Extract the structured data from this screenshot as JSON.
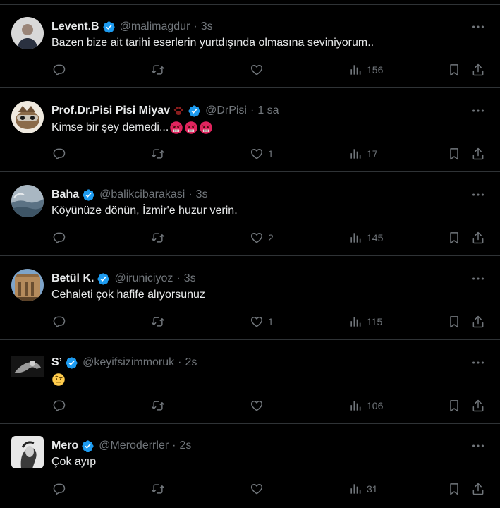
{
  "theme": {
    "background": "#000000",
    "text": "#e7e9ea",
    "muted": "#71767b",
    "divider": "#2f3336",
    "verified_blue": "#1d9bf0"
  },
  "icons": {
    "verified": "verified-badge-icon",
    "more": "more-horizontal-icon",
    "reply": "reply-icon",
    "retweet": "retweet-icon",
    "like": "like-icon",
    "views": "views-icon",
    "bookmark": "bookmark-icon",
    "share": "share-icon"
  },
  "tweets": [
    {
      "name": "Levent.B",
      "handle": "@malimagdur",
      "time": "3s",
      "text": "Bazen bize ait tarihi eserlerin yurtdışında olmasına seviniyorum..",
      "likes": "",
      "views": "156"
    },
    {
      "name": "Prof.Dr.Pisi Pisi Miyav",
      "handle": "@DrPisi",
      "time": "1 sa",
      "text": "Kimse bir şey demedi...",
      "emoji": "angry-face x3",
      "likes": "1",
      "views": "17"
    },
    {
      "name": "Baha",
      "handle": "@balikcibarakasi",
      "time": "3s",
      "text": "Köyünüze dönün, İzmir'e huzur verin.",
      "likes": "2",
      "views": "145"
    },
    {
      "name": "Betül K.",
      "handle": "@iruniciyoz",
      "time": "3s",
      "text": "Cehaleti çok hafife alıyorsunuz",
      "likes": "1",
      "views": "115"
    },
    {
      "name": "S’",
      "handle": "@keyifsizimmoruk",
      "time": "2s",
      "text": "",
      "emoji": "face-with-raised-eyebrow",
      "likes": "",
      "views": "106"
    },
    {
      "name": "Mero",
      "handle": "@Meroderrler",
      "time": "2s",
      "text": "Çok ayıp",
      "likes": "",
      "views": "31"
    }
  ]
}
